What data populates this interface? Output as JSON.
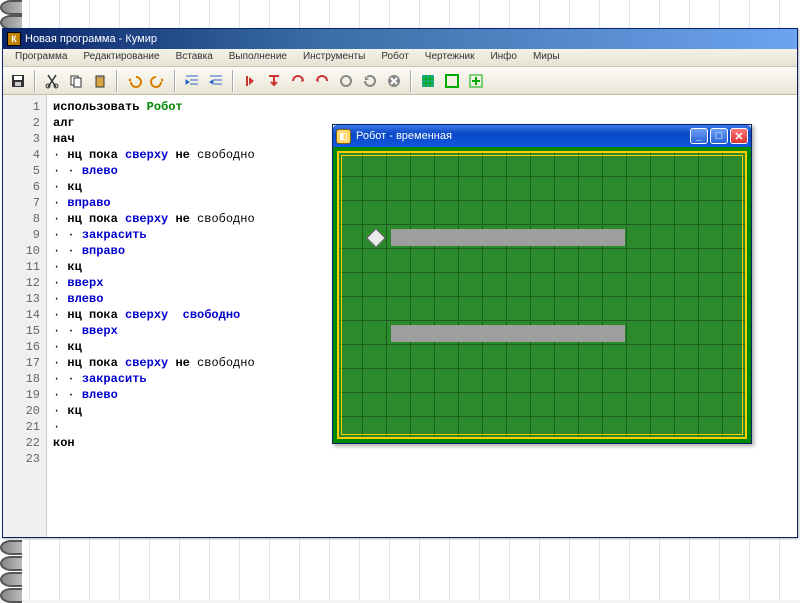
{
  "ide": {
    "title": "Новая программа - Кумир",
    "appicon_letter": "К"
  },
  "menu": {
    "items": [
      "Программа",
      "Редактирование",
      "Вставка",
      "Выполнение",
      "Инструменты",
      "Робот",
      "Чертежник",
      "Инфо",
      "Миры"
    ]
  },
  "toolbar_icons": [
    "save-icon",
    "cut-icon",
    "copy-icon",
    "paste-icon",
    "undo-icon",
    "redo-icon",
    "indent-icon",
    "outdent-icon",
    "run-icon",
    "step-into-icon",
    "step-over-icon",
    "step-back-icon",
    "step-forward-icon",
    "refresh-icon",
    "stop-icon",
    "grid-green-icon",
    "grid-outline-icon",
    "grid-add-icon"
  ],
  "code": {
    "lines": [
      {
        "n": 1,
        "t": [
          {
            "s": "использовать ",
            "c": "kw-bold"
          },
          {
            "s": "Робот",
            "c": "kw-green"
          }
        ]
      },
      {
        "n": 2,
        "t": [
          {
            "s": "алг",
            "c": "kw-bold"
          }
        ]
      },
      {
        "n": 3,
        "t": [
          {
            "s": "нач",
            "c": "kw-bold"
          }
        ]
      },
      {
        "n": 4,
        "t": [
          {
            "s": "· ",
            "c": "dot"
          },
          {
            "s": "нц пока ",
            "c": "kw-bold"
          },
          {
            "s": "сверху ",
            "c": "kw-blue"
          },
          {
            "s": "не ",
            "c": "kw-bold"
          },
          {
            "s": "свободно",
            "c": ""
          }
        ]
      },
      {
        "n": 5,
        "t": [
          {
            "s": "· · ",
            "c": "dot"
          },
          {
            "s": "влево",
            "c": "kw-blue"
          }
        ]
      },
      {
        "n": 6,
        "t": [
          {
            "s": "· ",
            "c": "dot"
          },
          {
            "s": "кц",
            "c": "kw-bold"
          }
        ]
      },
      {
        "n": 7,
        "t": [
          {
            "s": "· ",
            "c": "dot"
          },
          {
            "s": "вправо",
            "c": "kw-blue"
          }
        ]
      },
      {
        "n": 8,
        "t": [
          {
            "s": "· ",
            "c": "dot"
          },
          {
            "s": "нц пока ",
            "c": "kw-bold"
          },
          {
            "s": "сверху ",
            "c": "kw-blue"
          },
          {
            "s": "не ",
            "c": "kw-bold"
          },
          {
            "s": "свободно",
            "c": ""
          }
        ]
      },
      {
        "n": 9,
        "t": [
          {
            "s": "· · ",
            "c": "dot"
          },
          {
            "s": "закрасить",
            "c": "kw-blue"
          }
        ]
      },
      {
        "n": 10,
        "t": [
          {
            "s": "· · ",
            "c": "dot"
          },
          {
            "s": "вправо",
            "c": "kw-blue"
          }
        ]
      },
      {
        "n": 11,
        "t": [
          {
            "s": "· ",
            "c": "dot"
          },
          {
            "s": "кц",
            "c": "kw-bold"
          }
        ]
      },
      {
        "n": 12,
        "t": [
          {
            "s": "· ",
            "c": "dot"
          },
          {
            "s": "вверх",
            "c": "kw-blue"
          }
        ]
      },
      {
        "n": 13,
        "t": [
          {
            "s": "· ",
            "c": "dot"
          },
          {
            "s": "влево",
            "c": "kw-blue"
          }
        ]
      },
      {
        "n": 14,
        "t": [
          {
            "s": "· ",
            "c": "dot"
          },
          {
            "s": "нц пока ",
            "c": "kw-bold"
          },
          {
            "s": "сверху  ",
            "c": "kw-blue"
          },
          {
            "s": "свободно",
            "c": "kw-blue"
          }
        ]
      },
      {
        "n": 15,
        "t": [
          {
            "s": "· · ",
            "c": "dot"
          },
          {
            "s": "вверх",
            "c": "kw-blue"
          }
        ]
      },
      {
        "n": 16,
        "t": [
          {
            "s": "· ",
            "c": "dot"
          },
          {
            "s": "кц",
            "c": "kw-bold"
          }
        ]
      },
      {
        "n": 17,
        "t": [
          {
            "s": "· ",
            "c": "dot"
          },
          {
            "s": "нц пока ",
            "c": "kw-bold"
          },
          {
            "s": "сверху ",
            "c": "kw-blue"
          },
          {
            "s": "не ",
            "c": "kw-bold"
          },
          {
            "s": "свободно",
            "c": ""
          }
        ]
      },
      {
        "n": 18,
        "t": [
          {
            "s": "· · ",
            "c": "dot"
          },
          {
            "s": "закрасить",
            "c": "kw-blue"
          }
        ]
      },
      {
        "n": 19,
        "t": [
          {
            "s": "· · ",
            "c": "dot"
          },
          {
            "s": "влево",
            "c": "kw-blue"
          }
        ]
      },
      {
        "n": 20,
        "t": [
          {
            "s": "· ",
            "c": "dot"
          },
          {
            "s": "кц",
            "c": "kw-bold"
          }
        ]
      },
      {
        "n": 21,
        "t": [
          {
            "s": "·",
            "c": "dot"
          }
        ]
      },
      {
        "n": 22,
        "t": [
          {
            "s": "кон",
            "c": "kw-bold"
          }
        ]
      },
      {
        "n": 23,
        "t": [
          {
            "s": "",
            "c": ""
          }
        ]
      }
    ]
  },
  "robot": {
    "title": "Робот - временная",
    "grid": {
      "cols": 16,
      "rows": 12,
      "cell": 24
    },
    "robot_pos": {
      "col": 1,
      "row": 3
    },
    "walls": [
      {
        "col_start": 2,
        "col_end": 11,
        "row": 3
      },
      {
        "col_start": 2,
        "col_end": 11,
        "row": 7
      }
    ]
  }
}
